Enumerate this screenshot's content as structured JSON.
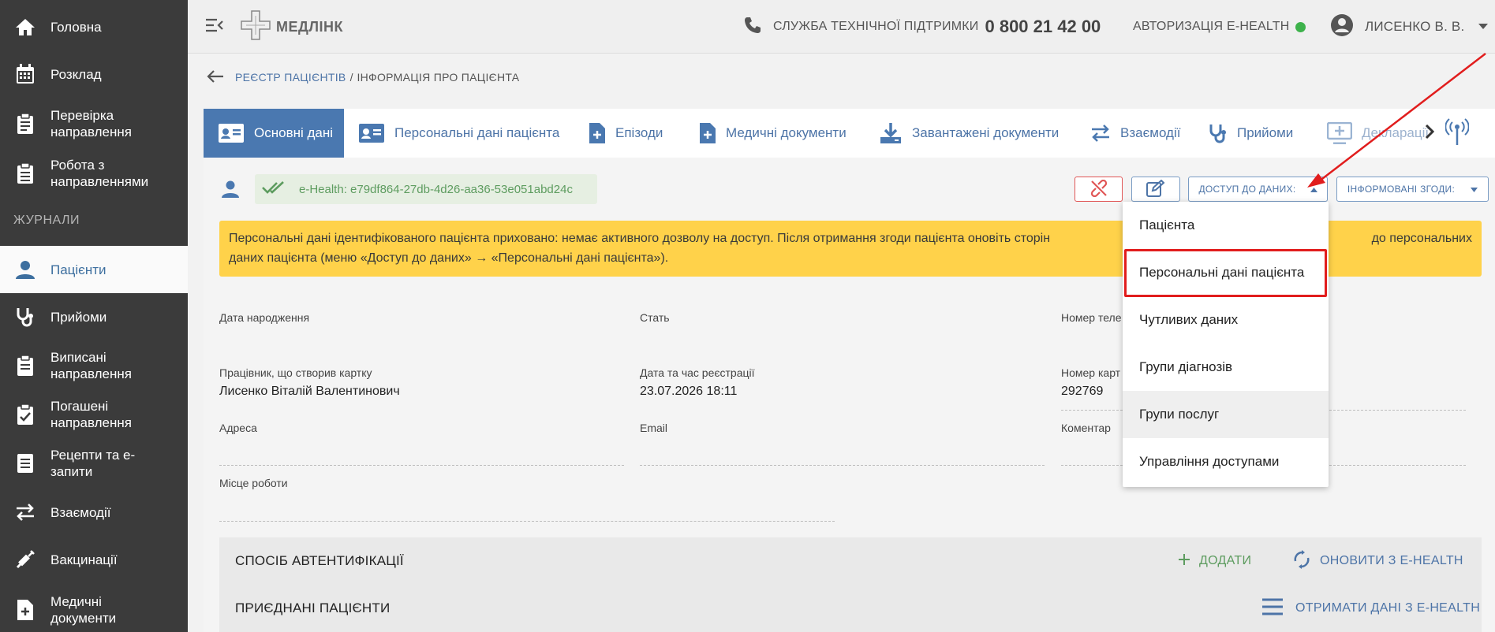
{
  "sidebar": {
    "items": [
      {
        "label": "Головна"
      },
      {
        "label": "Розклад"
      },
      {
        "label": "Перевірка\nнаправлення"
      },
      {
        "label": "Робота з\nнаправленнями"
      },
      {
        "label": "Пацієнти"
      },
      {
        "label": "Прийоми"
      },
      {
        "label": "Виписані\nнаправлення"
      },
      {
        "label": "Погашені\nнаправлення"
      },
      {
        "label": "Рецепти та е-\nзапити"
      },
      {
        "label": "Взаємодії"
      },
      {
        "label": "Вакцинації"
      },
      {
        "label": "Медичні\nдокументи"
      }
    ],
    "section_label": "ЖУРНАЛИ"
  },
  "topbar": {
    "logo_text": "МЕДЛІНК",
    "support_label": "СЛУЖБА ТЕХНІЧНОЇ ПІДТРИМКИ",
    "support_phone": "0 800 21 42 00",
    "ehealth_auth_label": "АВТОРИЗАЦІЯ E-HEALTH",
    "ehealth_status_color": "#3db24b",
    "user_name": "ЛИСЕНКО В. В."
  },
  "breadcrumb": {
    "link": "РЕЄСТР ПАЦІЄНТІВ",
    "separator": "/",
    "current": "ІНФОРМАЦІЯ ПРО ПАЦІЄНТА"
  },
  "tabs": [
    {
      "label": "Основні дані"
    },
    {
      "label": "Персональні дані пацієнта"
    },
    {
      "label": "Епізоди"
    },
    {
      "label": "Медичні документи"
    },
    {
      "label": "Завантажені документи"
    },
    {
      "label": "Взаємодії"
    },
    {
      "label": "Прийоми"
    },
    {
      "label": "Декларації"
    }
  ],
  "patient": {
    "ehealth_id": "e-Health: e79df864-27db-4d26-aa36-53e051abd24c",
    "access_button": "ДОСТУП ДО ДАНИХ:",
    "consent_button": "ІНФОРМОВАНІ ЗГОДИ:"
  },
  "warning": {
    "line1": "Персональні дані ідентифікованого пацієнта приховано: немає активного дозволу на доступ. Після отримання згоди пацієнта оновіть сторін",
    "line1_tail": "до персональних",
    "line2": "даних пацієнта (меню «Доступ до даних» → «Персональні дані пацієнта»)."
  },
  "fields": {
    "birth_date": {
      "label": "Дата народження",
      "value": ""
    },
    "gender": {
      "label": "Стать",
      "value": ""
    },
    "phone": {
      "label": "Номер теле",
      "value": ""
    },
    "creator": {
      "label": "Працівник, що створив картку",
      "value": "Лисенко Віталій Валентинович"
    },
    "reg_datetime": {
      "label": "Дата та час реєстрації",
      "value": "23.07.2026 18:11"
    },
    "card_number": {
      "label": "Номер карт",
      "value": "292769"
    },
    "address": {
      "label": "Адреса",
      "value": ""
    },
    "email": {
      "label": "Email",
      "value": ""
    },
    "comment": {
      "label": "Коментар",
      "value": ""
    },
    "workplace": {
      "label": "Місце роботи",
      "value": ""
    }
  },
  "sections": {
    "auth": {
      "title": "СПОСІБ АВТЕНТИФІКАЦІЇ",
      "add": "ДОДАТИ",
      "refresh": "ОНОВИТИ З E-HEALTH"
    },
    "linked": {
      "title": "ПРИЄДНАНІ ПАЦІЄНТИ",
      "fetch": "ОТРИМАТИ ДАНІ З E-HEALTH"
    }
  },
  "dropdown": {
    "items": [
      {
        "label": "Пацієнта"
      },
      {
        "label": "Персональні дані пацієнта"
      },
      {
        "label": "Чутливих даних"
      },
      {
        "label": "Групи діагнозів"
      },
      {
        "label": "Групи послуг"
      },
      {
        "label": "Управління доступами"
      }
    ]
  },
  "colors": {
    "sidebar_bg": "#3b3b3b",
    "accent": "#4a78b0",
    "warning_bg": "#ffd24a",
    "annotation_red": "#e11d1d"
  }
}
